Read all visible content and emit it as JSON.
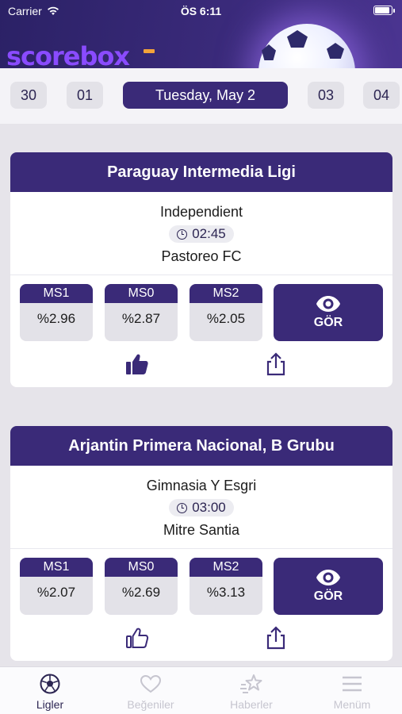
{
  "status_bar": {
    "carrier": "Carrier",
    "time": "ÖS 6:11"
  },
  "app": {
    "logo_text": "scorebox",
    "accent": "#3a2a78",
    "brand_purple": "#8a4bff"
  },
  "dates": [
    {
      "label": "30",
      "active": false
    },
    {
      "label": "01",
      "active": false
    },
    {
      "label": "Tuesday, May 2",
      "active": true
    },
    {
      "label": "03",
      "active": false
    },
    {
      "label": "04",
      "active": false
    }
  ],
  "matches": [
    {
      "league": "Paraguay Intermedia Ligi",
      "home": "Independient",
      "time": "02:45",
      "away": "Pastoreo FC",
      "odds": [
        {
          "label": "MS1",
          "value": "%2.96"
        },
        {
          "label": "MS0",
          "value": "%2.87"
        },
        {
          "label": "MS2",
          "value": "%2.05"
        }
      ],
      "see_label": "GÖR",
      "liked": true
    },
    {
      "league": "Arjantin Primera Nacional, B Grubu",
      "home": "Gimnasia Y Esgri",
      "time": "03:00",
      "away": "Mitre Santia",
      "odds": [
        {
          "label": "MS1",
          "value": "%2.07"
        },
        {
          "label": "MS0",
          "value": "%2.69"
        },
        {
          "label": "MS2",
          "value": "%3.13"
        }
      ],
      "see_label": "GÖR",
      "liked": false
    }
  ],
  "tabs": [
    {
      "label": "Ligler",
      "icon": "soccer-ball-icon",
      "active": true
    },
    {
      "label": "Beğeniler",
      "icon": "heart-icon",
      "active": false
    },
    {
      "label": "Haberler",
      "icon": "star-icon",
      "active": false
    },
    {
      "label": "Menüm",
      "icon": "menu-icon",
      "active": false
    }
  ]
}
